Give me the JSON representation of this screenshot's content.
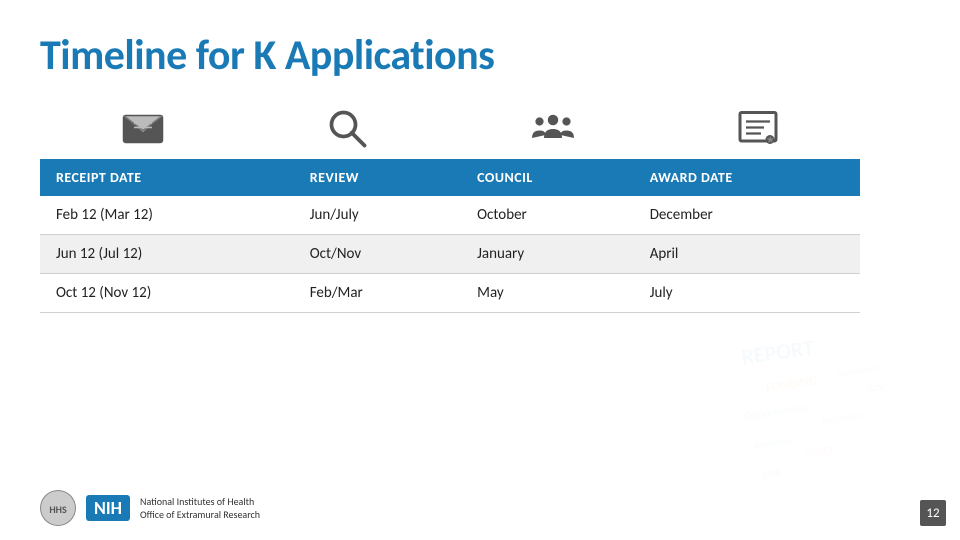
{
  "title": "Timeline for K Applications",
  "icons": [
    {
      "name": "envelope-icon",
      "type": "envelope"
    },
    {
      "name": "search-icon",
      "type": "search"
    },
    {
      "name": "council-icon",
      "type": "group"
    },
    {
      "name": "award-icon",
      "type": "certificate"
    }
  ],
  "table": {
    "headers": [
      "RECEIPT DATE",
      "REVIEW",
      "COUNCIL",
      "AWARD DATE"
    ],
    "rows": [
      [
        "Feb 12 (Mar 12)",
        "Jun/July",
        "October",
        "December"
      ],
      [
        "Jun 12 (Jul 12)",
        "Oct/Nov",
        "January",
        "April"
      ],
      [
        "Oct 12 (Nov 12)",
        "Feb/Mar",
        "May",
        "July"
      ]
    ]
  },
  "footer": {
    "org_line1": "National Institutes of Health",
    "org_line2": "Office of Extramural Research",
    "page_number": "12"
  }
}
